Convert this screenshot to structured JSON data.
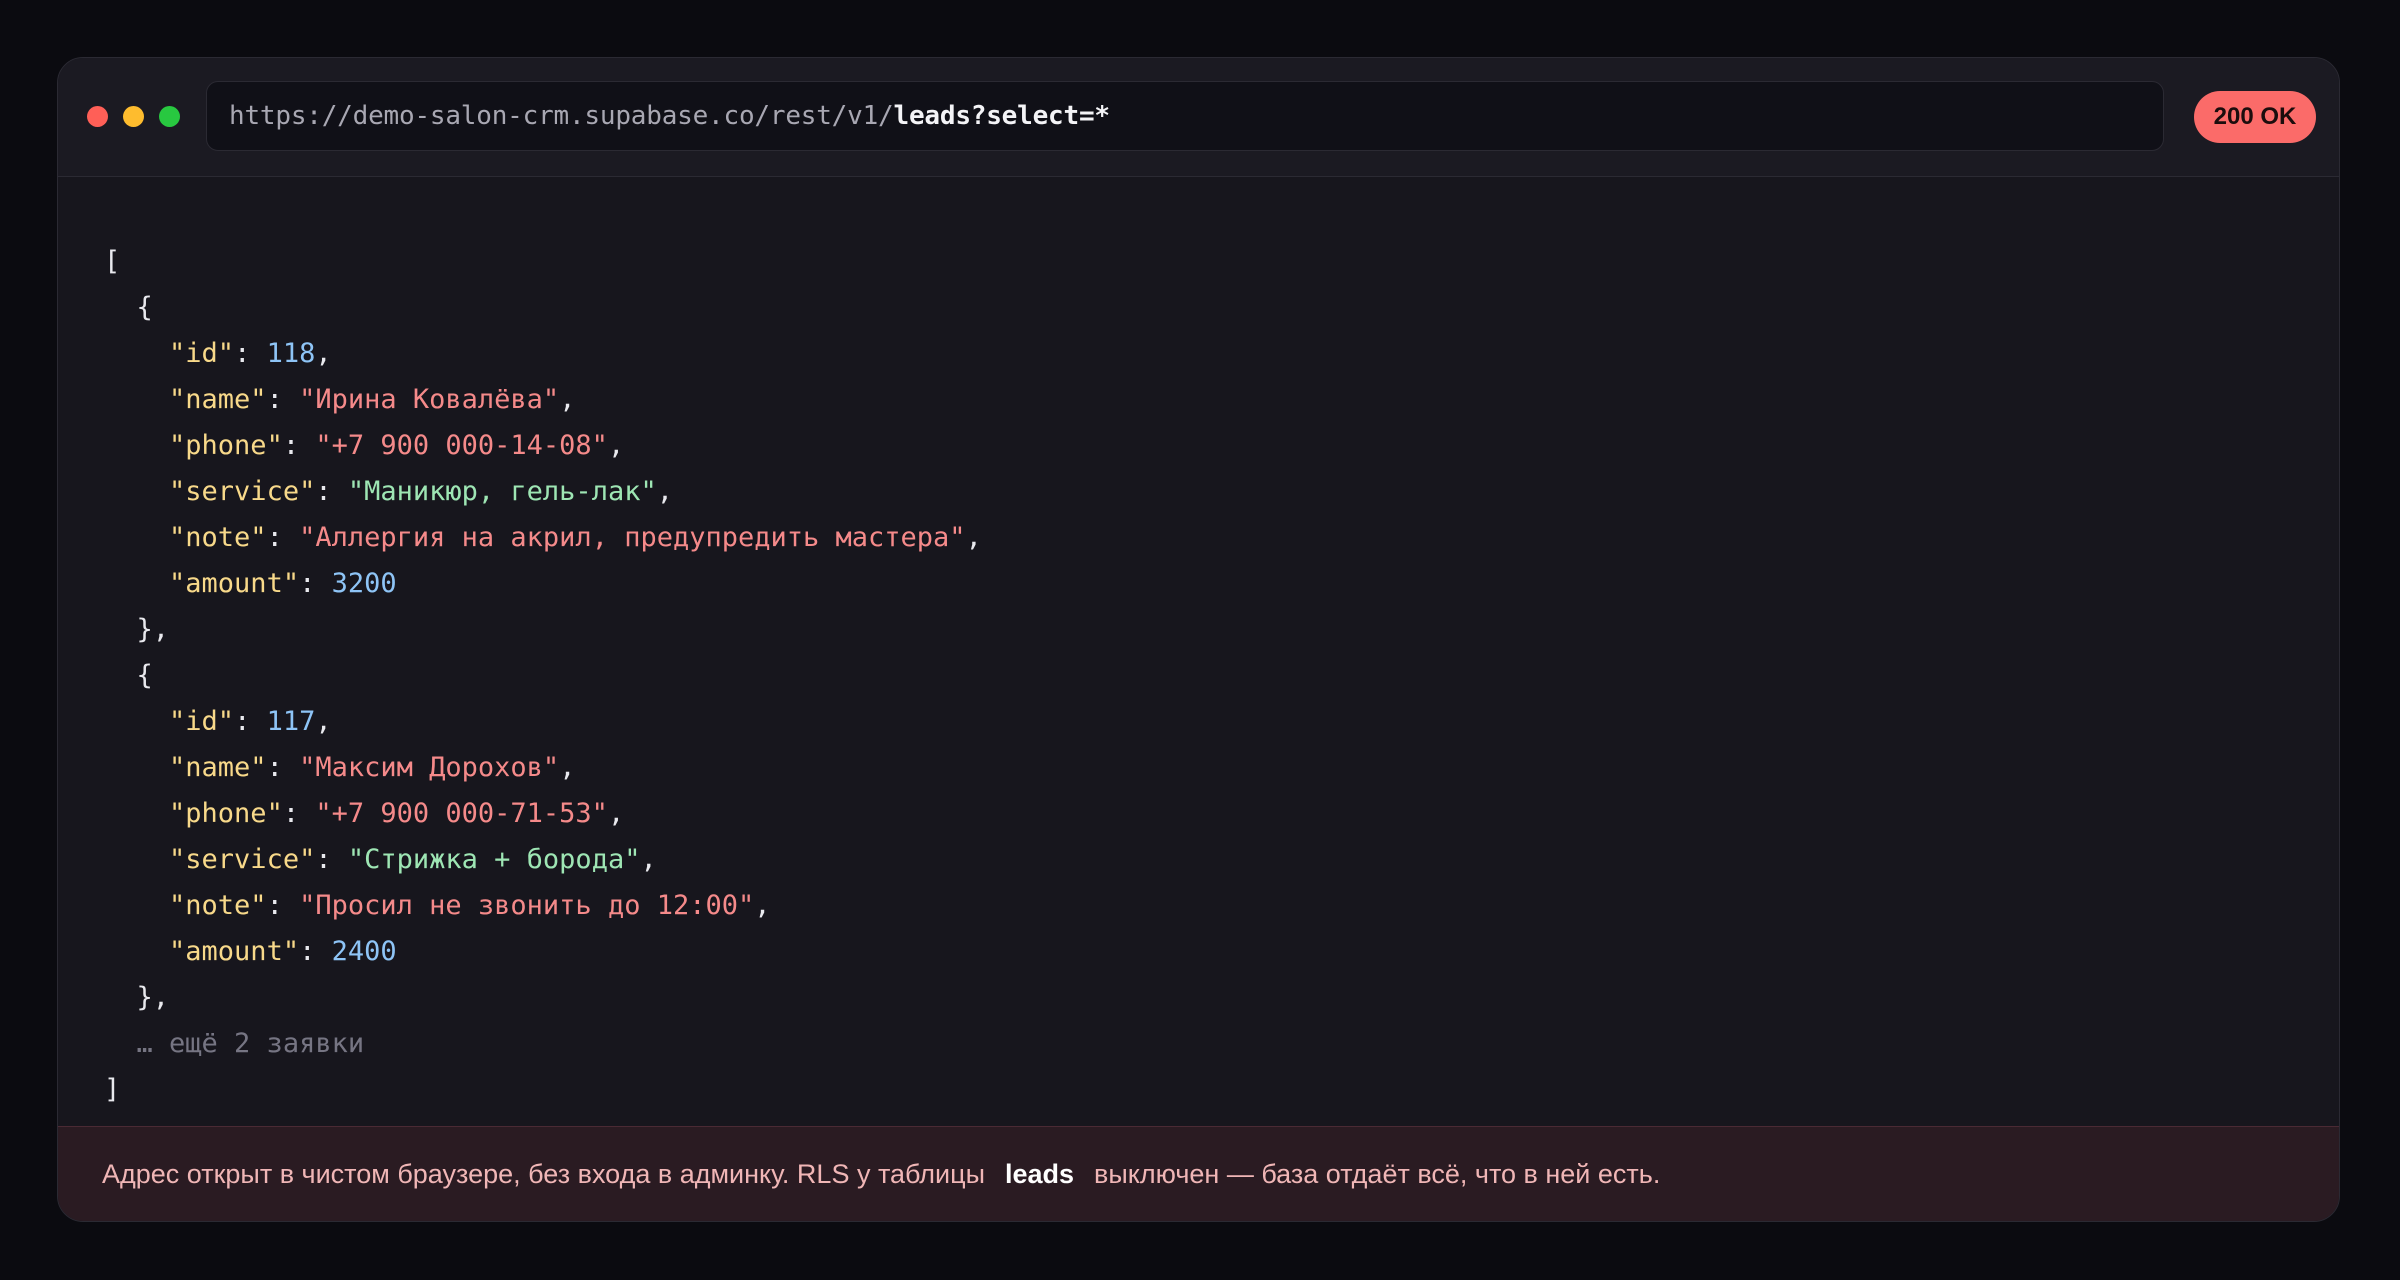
{
  "window": {
    "url": {
      "base": "https://demo-salon-crm.supabase.co/rest/v1/",
      "path": "leads?select=*"
    },
    "status": "200 OK"
  },
  "response": {
    "open_bracket": "[",
    "close_bracket": "]",
    "records": [
      {
        "id": "118",
        "name": "\"Ирина Ковалёва\"",
        "phone": "\"+7 900 000-14-08\"",
        "service": "\"Маникюр, гель-лак\"",
        "note": "\"Аллергия на акрил, предупредить мастера\"",
        "amount": "3200"
      },
      {
        "id": "117",
        "name": "\"Максим Дорохов\"",
        "phone": "\"+7 900 000-71-53\"",
        "service": "\"Стрижка + борода\"",
        "note": "\"Просил не звонить до 12:00\"",
        "amount": "2400"
      }
    ],
    "keys": {
      "id": "\"id\"",
      "name": "\"name\"",
      "phone": "\"phone\"",
      "service": "\"service\"",
      "note": "\"note\"",
      "amount": "\"amount\""
    },
    "more_text": "… ещё 2 заявки"
  },
  "footer": {
    "text_before": "Адрес открыт в чистом браузере, без входа в админку. RLS у таблицы",
    "table_name": "leads",
    "text_after": "выключен — база отдаёт всё, что в ней есть."
  },
  "colors": {
    "background": "#0b0b10",
    "window": "#17161d",
    "status_badge": "#fb6b69",
    "json_key": "#f8d98a",
    "json_number": "#8ec4f6",
    "json_string": "#f58a8a",
    "json_service_string": "#9ee6b4"
  }
}
